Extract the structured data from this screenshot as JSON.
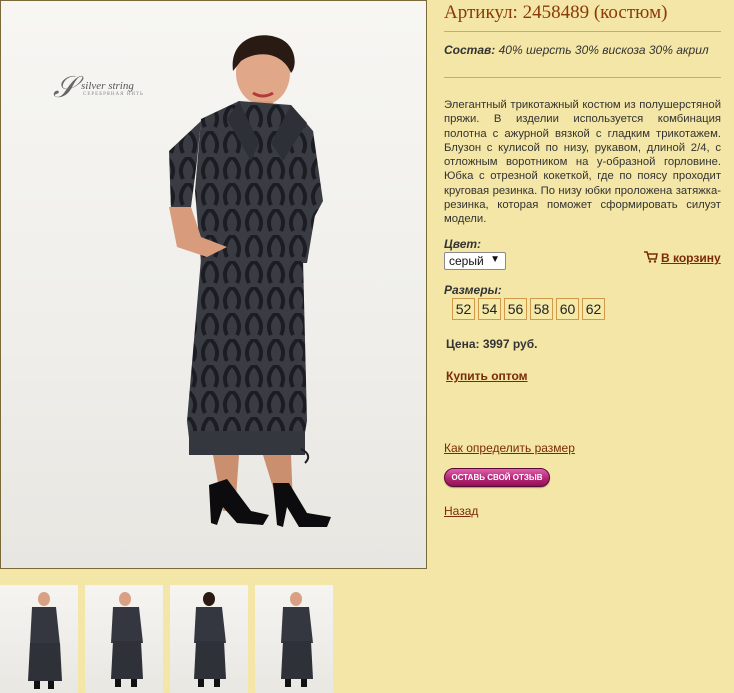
{
  "product": {
    "title": "Артикул: 2458489 (костюм)",
    "composition_label": "Состав:",
    "composition_value": "40% шерсть 30% вискоза 30% акрил",
    "description": "Элегантный трикотажный костюм из полушерстяной пряжи. В изделии используется комбинация полотна с ажурной вязкой с гладким трикотажем. Блузон с кулисой по низу, рукавом, длиной 2/4, с отложным воротником на у-образной горловине. Юбка с отрезной кокеткой, где по поясу проходит круговая резинка. По низу юбки проложена затяжка-резинка, которая поможет сформировать силуэт модели."
  },
  "brand": {
    "logo_text": "Silver string",
    "logo_sub": "ТОРГОВАЯ МАРКА"
  },
  "color": {
    "label": "Цвет:",
    "selected": "серый"
  },
  "cart": {
    "label": "В корзину"
  },
  "sizes": {
    "label": "Размеры:",
    "items": [
      "52",
      "54",
      "56",
      "58",
      "60",
      "62"
    ]
  },
  "price": {
    "text": "Цена: 3997 руб."
  },
  "links": {
    "wholesale": "Купить оптом",
    "size_guide": "Как определить размер",
    "review": "ОСТАВЬ СВОЙ ОТЗЫВ",
    "back": "Назад"
  },
  "colors": {
    "accent": "#7a2a08",
    "title": "#8a3a0a",
    "background": "#f3e6a6",
    "review_button": "#b82475"
  }
}
